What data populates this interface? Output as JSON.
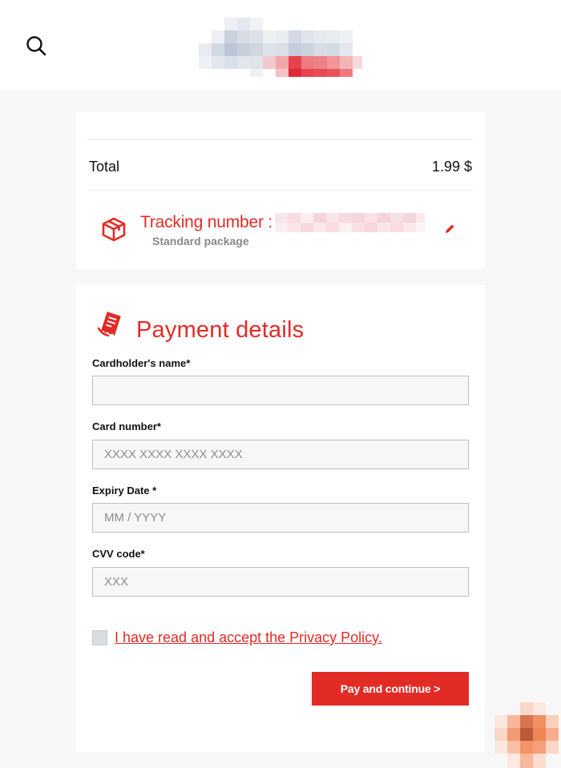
{
  "header": {
    "search_icon": "search-icon",
    "logo_icon": "brand-logo"
  },
  "summary": {
    "total_label": "Total",
    "total_value": "1.99 $",
    "tracking_label": "Tracking number :",
    "tracking_sub": "Standard package",
    "tracking_icon": "package-box-icon",
    "edit_icon": "pencil-icon"
  },
  "payment": {
    "title": "Payment details",
    "title_icon": "receipt-icon",
    "fields": [
      {
        "label": "Cardholder's name*",
        "placeholder": "",
        "value": ""
      },
      {
        "label": "Card number*",
        "placeholder": "XXXX XXXX XXXX XXXX",
        "value": ""
      },
      {
        "label": "Expiry Date *",
        "placeholder": "MM / YYYY",
        "value": ""
      },
      {
        "label": "CVV code*",
        "placeholder": "XXX",
        "value": ""
      }
    ],
    "consent_text": "I have read and accept the Privacy Policy.",
    "submit_label": "Pay and continue >"
  },
  "colors": {
    "accent": "#e32b26",
    "background": "#f7f7f7",
    "card": "#ffffff",
    "input_bg": "#f7f7f7",
    "input_border": "#bfbfbf"
  }
}
